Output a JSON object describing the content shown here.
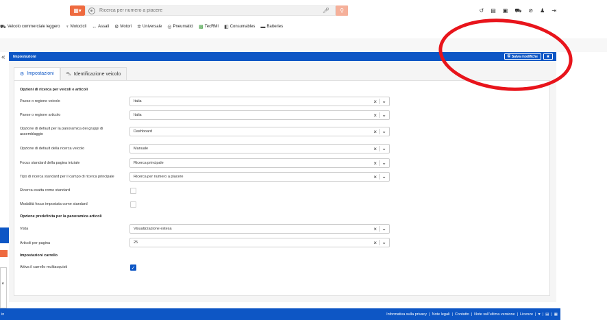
{
  "topbar": {
    "menu_icon": "grid-icon",
    "search_placeholder": "Ricerca per numero a piacere",
    "search_icon": "search-icon",
    "icons": [
      "history-icon",
      "document-icon",
      "monitor-icon",
      "cart-icon",
      "no-cart-icon",
      "user-icon",
      "logout-icon"
    ]
  },
  "categories": [
    {
      "label": "Veicolo commerciale leggero",
      "icon": "van-icon"
    },
    {
      "label": "Motocicli",
      "icon": "motorcycle-icon"
    },
    {
      "label": "Assali",
      "icon": "axle-icon"
    },
    {
      "label": "Motori",
      "icon": "engine-icon"
    },
    {
      "label": "Universale",
      "icon": "gear-icon"
    },
    {
      "label": "Pneumatici",
      "icon": "tire-icon"
    },
    {
      "label": "TecRMI",
      "icon": "tecrmi-icon"
    },
    {
      "label": "Consumables",
      "icon": "oil-icon"
    },
    {
      "label": "Batteries",
      "icon": "battery-icon"
    }
  ],
  "panel": {
    "title": "Impostazioni",
    "save_label": "Salva modifiche"
  },
  "tabs": [
    {
      "label": "Impostazioni",
      "active": true
    },
    {
      "label": "Identificazione veicolo",
      "active": false
    }
  ],
  "sections": {
    "search": "Opzioni di ricerca per veicoli e articoli",
    "overview": "Opzione predefinita per la panoramica articoli",
    "cart": "Impostazioni carrello"
  },
  "fields": {
    "paese_veicolo": {
      "label": "Paese o regione veicolo",
      "value": "Italia"
    },
    "paese_articolo": {
      "label": "Paese o regione articolo",
      "value": "Italia"
    },
    "panoramica": {
      "label": "Opzione di default per la panoramica dei gruppi di assemblaggio",
      "value": "Dashboard"
    },
    "ricerca_veicolo": {
      "label": "Opzione di default della ricerca veicolo",
      "value": "Manuale"
    },
    "focus": {
      "label": "Focus standard della pagina iniziale",
      "value": "Ricerca principale"
    },
    "tipo_ricerca": {
      "label": "Tipo di ricerca standard per il campo di ricerca principale",
      "value": "Ricerca per numero a piacere"
    },
    "ricerca_esatta": {
      "label": "Ricerca esatta come standard",
      "checked": false
    },
    "modalita_focus": {
      "label": "Modalità focus impostata come standard",
      "checked": false
    },
    "vista": {
      "label": "Vista",
      "value": "Visualizzazione estesa"
    },
    "articoli_pagina": {
      "label": "Articoli per pagina",
      "value": "25"
    },
    "multiacquisti": {
      "label": "Attiva il carrello multiacquisti",
      "checked": true
    }
  },
  "footer": {
    "links": [
      "Informativa sulla privacy",
      "Note legali",
      "Contatto",
      "Note sull'ultima versione",
      "Licenze"
    ],
    "left_text": "in"
  },
  "left_widget_text": "e",
  "colors": {
    "accent": "#0d56c5",
    "brand": "#ee6a3f",
    "annotation": "#e8141b"
  }
}
